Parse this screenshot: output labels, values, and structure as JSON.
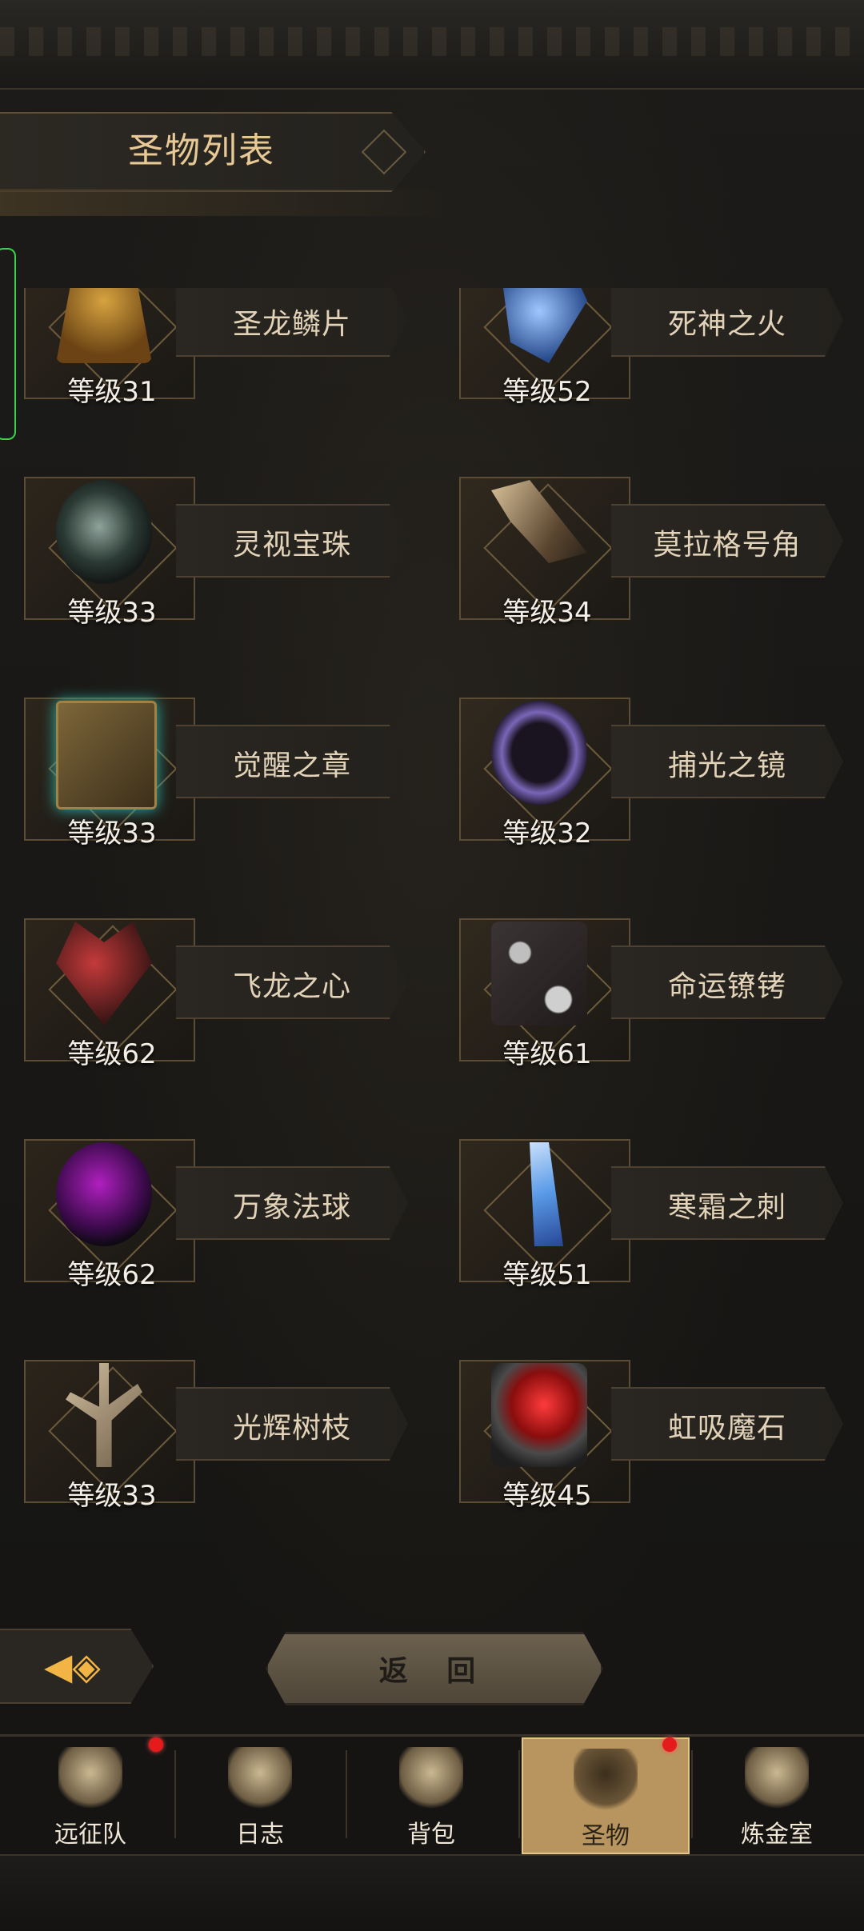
{
  "header": {
    "title": "圣物列表"
  },
  "relics": [
    {
      "name": "圣龙鳞片",
      "level": "等级31",
      "icon": "dragon-scale-icon"
    },
    {
      "name": "死神之火",
      "level": "等级52",
      "icon": "reaper-fire-icon"
    },
    {
      "name": "灵视宝珠",
      "level": "等级33",
      "icon": "vision-orb-icon"
    },
    {
      "name": "莫拉格号角",
      "level": "等级34",
      "icon": "horn-icon"
    },
    {
      "name": "觉醒之章",
      "level": "等级33",
      "icon": "book-icon"
    },
    {
      "name": "捕光之镜",
      "level": "等级32",
      "icon": "mirror-icon"
    },
    {
      "name": "飞龙之心",
      "level": "等级62",
      "icon": "heart-icon"
    },
    {
      "name": "命运镣铐",
      "level": "等级61",
      "icon": "shackles-icon"
    },
    {
      "name": "万象法球",
      "level": "等级62",
      "icon": "purple-orb-icon"
    },
    {
      "name": "寒霜之刺",
      "level": "等级51",
      "icon": "ice-shard-icon"
    },
    {
      "name": "光辉树枝",
      "level": "等级33",
      "icon": "branch-icon"
    },
    {
      "name": "虹吸魔石",
      "level": "等级45",
      "icon": "ruby-stone-icon"
    }
  ],
  "buttons": {
    "back": "返 回"
  },
  "nav": {
    "items": [
      {
        "label": "远征队",
        "icon": "viking-helmet-icon",
        "badge": true
      },
      {
        "label": "日志",
        "icon": "scroll-icon",
        "badge": false
      },
      {
        "label": "背包",
        "icon": "backpack-icon",
        "badge": false
      },
      {
        "label": "圣物",
        "icon": "torch-icon",
        "badge": true,
        "active": true
      },
      {
        "label": "炼金室",
        "icon": "alchemy-icon",
        "badge": false
      }
    ]
  }
}
